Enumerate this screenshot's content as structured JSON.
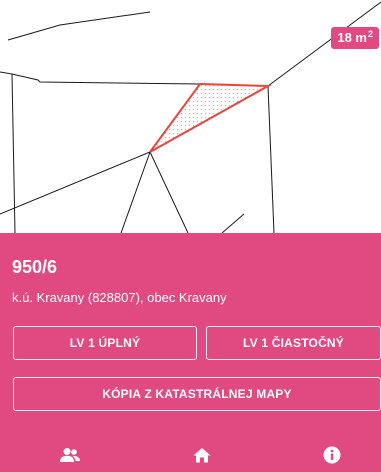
{
  "map": {
    "area_badge": {
      "value": "18 m",
      "unit_sup": "2"
    },
    "colors": {
      "parcel_outline": "#e8453c",
      "parcel_fill_dots": "#c8c8c8",
      "lines": "#1a1a1a"
    }
  },
  "parcel": {
    "number": "950/6",
    "location": "k.ú. Kravany (828807), obec Kravany"
  },
  "buttons": {
    "lv_full": "LV 1 ÚPLNÝ",
    "lv_partial": "LV 1 ČIASTOČNÝ",
    "map_copy": "KÓPIA Z KATASTRÁLNEJ MAPY"
  },
  "nav": {
    "items": [
      {
        "icon": "users-icon"
      },
      {
        "icon": "home-icon"
      },
      {
        "icon": "info-icon"
      }
    ]
  },
  "colors": {
    "accent": "#e14a81",
    "on_accent": "#ffffff"
  }
}
